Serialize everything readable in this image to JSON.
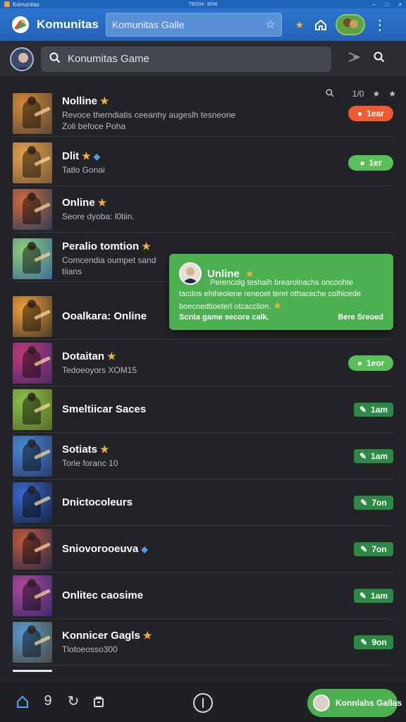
{
  "window": {
    "title": "Komunitas",
    "center_text": "TBD04- 3/04l",
    "controls": [
      "–",
      "□",
      "×"
    ]
  },
  "header": {
    "app_title": "Komunitas",
    "search_value": "Komunitas Galle",
    "icons": [
      "star-icon",
      "home-icon",
      "more-vertical-icon"
    ]
  },
  "searchbar": {
    "value": "Konumitas Game",
    "icons": [
      "search-icon",
      "share-icon",
      "search-icon"
    ]
  },
  "list_tools": {
    "count": "1/0"
  },
  "rows": [
    {
      "title": "Nolline",
      "sub": "Revoce therndiatis ceeanhy augeslh tesneone",
      "sub2": "Zoli befoce Poha",
      "badge": "1ear",
      "badge_style": "orange",
      "thumb": [
        "#d58a3a",
        "#5b4636"
      ]
    },
    {
      "title": "Dlit",
      "sub": "Tatlo Gonai",
      "sub2": "",
      "badge": "1er",
      "badge_style": "green",
      "thumb": [
        "#e1a14a",
        "#7a5a3c"
      ]
    },
    {
      "title": "Online",
      "sub": "Seore dyoba: l0tiin.",
      "sub2": "",
      "badge": "",
      "badge_style": "",
      "thumb": [
        "#d46a3b",
        "#2a3d5a"
      ]
    },
    {
      "title": "Peralio tomtion",
      "sub": "Comcendia oumpet sand",
      "sub2": "tiians",
      "badge": "",
      "badge_style": "",
      "thumb": [
        "#8fcf72",
        "#3d6a9a"
      ]
    },
    {
      "title": "Ooalkara: Online",
      "sub": "",
      "sub2": "",
      "badge": "",
      "badge_style": "",
      "thumb": [
        "#f2a13a",
        "#4a3a2c"
      ]
    },
    {
      "title": "Dotaitan",
      "sub": "Tedoeoyors XOM15",
      "sub2": "",
      "badge": "1eor",
      "badge_style": "green",
      "thumb": [
        "#c23a7a",
        "#4a2a6a"
      ]
    },
    {
      "title": "Smeltiicar Saces",
      "sub": "",
      "sub2": "",
      "badge": "1am",
      "badge_style": "darkgreen",
      "thumb": [
        "#8ac04a",
        "#5a6a2a"
      ]
    },
    {
      "title": "Sotiats",
      "sub": "Torle foranc 10",
      "sub2": "",
      "badge": "1am",
      "badge_style": "darkgreen",
      "thumb": [
        "#4a8ad4",
        "#2a3a6a"
      ]
    },
    {
      "title": "Dnictocoleurs",
      "sub": "",
      "sub2": "",
      "badge": "7on",
      "badge_style": "darkgreen",
      "thumb": [
        "#3a6ad4",
        "#1a2440"
      ]
    },
    {
      "title": "Sniovorooeuva",
      "sub": "",
      "sub2": "",
      "badge": "7on",
      "badge_style": "darkgreen",
      "thumb": [
        "#c45a3a",
        "#2a2a4a"
      ]
    },
    {
      "title": "Onlitec caosime",
      "sub": "",
      "sub2": "",
      "badge": "1am",
      "badge_style": "darkgreen",
      "thumb": [
        "#b04a9a",
        "#3a2a6a"
      ]
    },
    {
      "title": "Konnicer Gagls",
      "sub": "Tlotoeosso300",
      "sub2": "",
      "badge": "9on",
      "badge_style": "darkgreen",
      "thumb": [
        "#5a9ad4",
        "#4a4a3a"
      ]
    }
  ],
  "popup": {
    "title": "Unline",
    "body1": "Perencolg teshaih brearolnachs oncoohte",
    "body2": "tacdns ehiheolene reneoet teret othaceche colhicede",
    "body3": "boecnedtioeterl otcacclion.",
    "foot_left": "Scnta game secore calk.",
    "foot_right": "Bere Sreoed"
  },
  "bottombar": {
    "number": "9",
    "cta_label": "Konnlahs Gallas"
  },
  "colors": {
    "header": "#2c74cf",
    "accent_green": "#4caf50",
    "badge_orange": "#f05a32",
    "background": "#222327"
  }
}
